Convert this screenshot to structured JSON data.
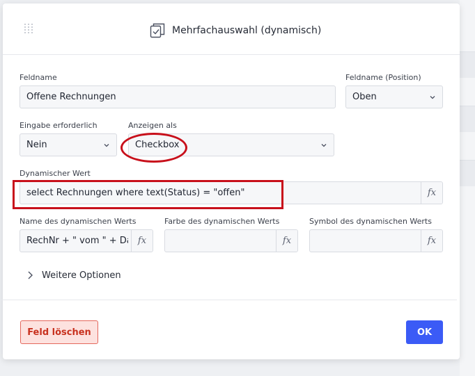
{
  "dialog": {
    "title": "Mehrfachauswahl (dynamisch)",
    "title_icon": "checkbox-stack-icon"
  },
  "fields": {
    "feldname": {
      "label": "Feldname",
      "value": "Offene Rechnungen"
    },
    "feldname_position": {
      "label": "Feldname (Position)",
      "value": "Oben"
    },
    "eingabe_erforderlich": {
      "label": "Eingabe erforderlich",
      "value": "Nein"
    },
    "anzeigen_als": {
      "label": "Anzeigen als",
      "value": "Checkbox"
    },
    "dynamischer_wert": {
      "label": "Dynamischer Wert",
      "value": "select Rechnungen where text(Status) = \"offen\""
    },
    "name_dyn_wert": {
      "label": "Name des dynamischen Werts",
      "value": "RechNr + \" vom \" + Datum"
    },
    "farbe_dyn_wert": {
      "label": "Farbe des dynamischen Werts",
      "value": ""
    },
    "symbol_dyn_wert": {
      "label": "Symbol des dynamischen Werts",
      "value": ""
    }
  },
  "fx_label": "fx",
  "more_options": {
    "label": "Weitere Optionen",
    "icon": "chevron-right-icon"
  },
  "buttons": {
    "delete": "Feld löschen",
    "ok": "OK"
  },
  "colors": {
    "annotation": "#c8101b",
    "primary": "#3b5bf6",
    "danger": "#c8321f"
  }
}
